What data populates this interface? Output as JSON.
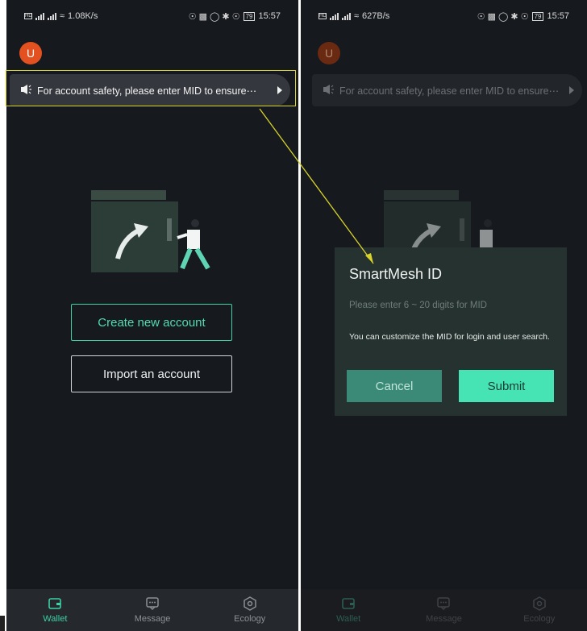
{
  "left_screen": {
    "status": {
      "speed": "1.08K/s",
      "battery": "79",
      "time": "15:57"
    },
    "avatar_letter": "U",
    "notice_text": "For account safety, please enter MID to ensure⋯",
    "create_label": "Create new account",
    "import_label": "Import an account",
    "tabs": [
      {
        "label": "Wallet",
        "icon": "wallet-icon",
        "active": true
      },
      {
        "label": "Message",
        "icon": "message-icon",
        "active": false
      },
      {
        "label": "Ecology",
        "icon": "ecology-icon",
        "active": false
      }
    ]
  },
  "right_screen": {
    "status": {
      "speed": "627B/s",
      "battery": "79",
      "time": "15:57"
    },
    "avatar_letter": "U",
    "notice_text": "For account safety, please enter MID to ensure⋯",
    "dialog": {
      "title": "SmartMesh ID",
      "placeholder": "Please enter 6 ~ 20 digits for MID",
      "description": "You can customize the MID for login and user search.",
      "cancel_label": "Cancel",
      "submit_label": "Submit"
    },
    "tabs": [
      {
        "label": "Wallet",
        "icon": "wallet-icon",
        "active": true
      },
      {
        "label": "Message",
        "icon": "message-icon",
        "active": false
      },
      {
        "label": "Ecology",
        "icon": "ecology-icon",
        "active": false
      }
    ]
  },
  "colors": {
    "accent": "#3cd1a7",
    "avatar": "#e2511f",
    "annotation": "#d8d42a",
    "background": "#16191e"
  }
}
